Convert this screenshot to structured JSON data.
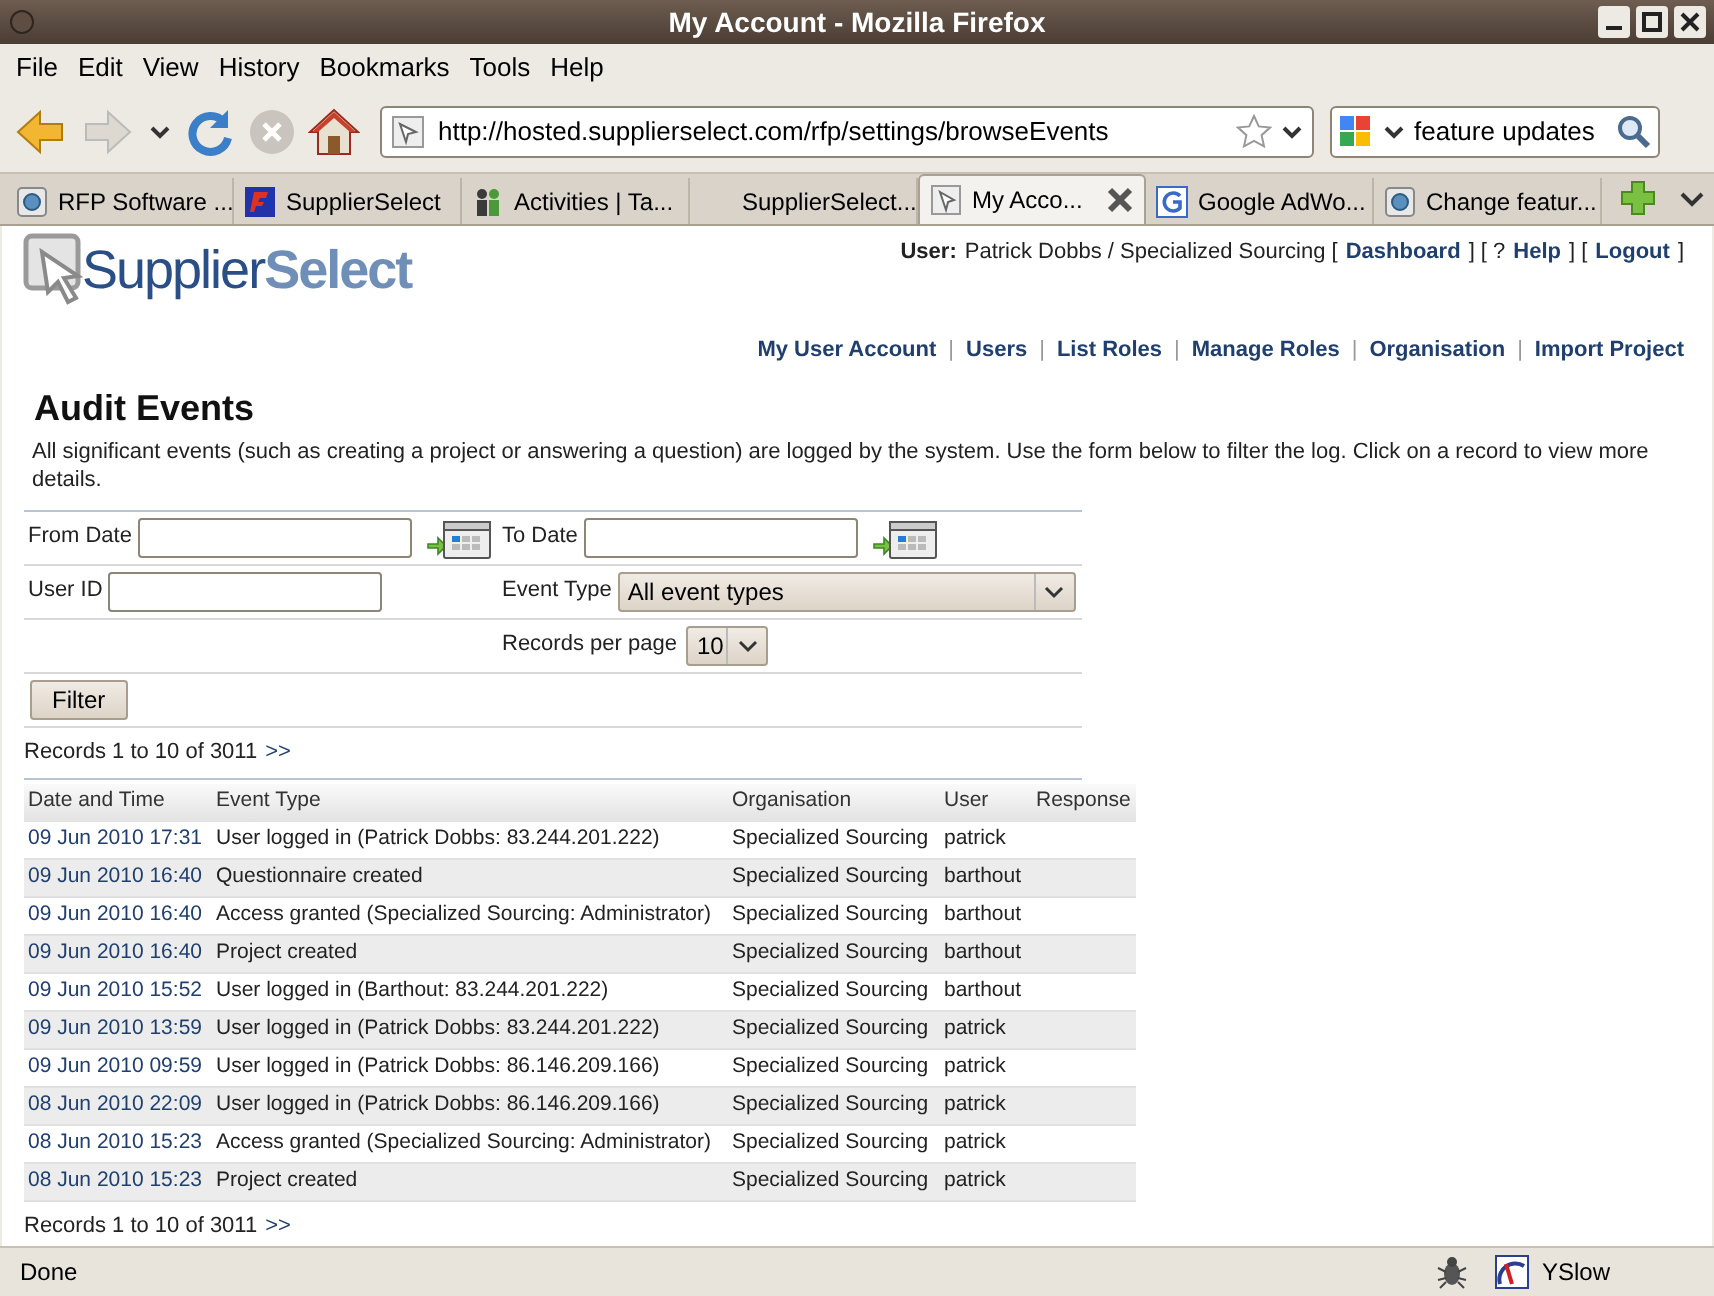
{
  "window": {
    "title": "My Account - Mozilla Firefox"
  },
  "menu": [
    "File",
    "Edit",
    "View",
    "History",
    "Bookmarks",
    "Tools",
    "Help"
  ],
  "nav_buttons": [
    {
      "kind": "back",
      "disabled": false
    },
    {
      "kind": "forward",
      "disabled": true
    },
    {
      "kind": "history",
      "disabled": false
    },
    {
      "kind": "reload",
      "disabled": false
    },
    {
      "kind": "stop",
      "disabled": true
    },
    {
      "kind": "home",
      "disabled": false
    }
  ],
  "address_bar": {
    "url": "http://hosted.supplierselect.com/rfp/settings/browseEvents"
  },
  "search_bar": {
    "value": "feature updates"
  },
  "tabs": [
    {
      "label": "RFP Software ...",
      "kind": "globe",
      "selected": false
    },
    {
      "label": "SupplierSelect",
      "kind": "logo",
      "selected": false
    },
    {
      "label": "Activities | Ta...",
      "kind": "people",
      "selected": false
    },
    {
      "label": "SupplierSelect...",
      "kind": "blank",
      "selected": false
    },
    {
      "label": "My Acco...",
      "kind": "page",
      "selected": true
    },
    {
      "label": "Google AdWo...",
      "kind": "google",
      "selected": false
    },
    {
      "label": "Change featur...",
      "kind": "globe",
      "selected": false
    }
  ],
  "page": {
    "logo": {
      "part_1": "Supplier",
      "part_2": "Select"
    },
    "user_bar": [
      {
        "kind": "label",
        "text": "User:"
      },
      {
        "kind": "text",
        "text": "Patrick Dobbs / Specialized Sourcing ["
      },
      {
        "kind": "link",
        "text": "Dashboard"
      },
      {
        "kind": "text",
        "text": "] [ ?"
      },
      {
        "kind": "link",
        "text": "Help"
      },
      {
        "kind": "text",
        "text": "] ["
      },
      {
        "kind": "link",
        "text": "Logout"
      },
      {
        "kind": "text",
        "text": "]"
      }
    ],
    "nav_links": [
      {
        "kind": "link",
        "text": "My User Account"
      },
      {
        "kind": "sep",
        "text": "|"
      },
      {
        "kind": "link",
        "text": "Users"
      },
      {
        "kind": "sep",
        "text": "|"
      },
      {
        "kind": "link",
        "text": "List Roles"
      },
      {
        "kind": "sep",
        "text": "|"
      },
      {
        "kind": "link",
        "text": "Manage Roles"
      },
      {
        "kind": "sep",
        "text": "|"
      },
      {
        "kind": "link",
        "text": "Organisation"
      },
      {
        "kind": "sep",
        "text": "|"
      },
      {
        "kind": "link",
        "text": "Import Project"
      }
    ],
    "heading": "Audit Events",
    "intro": "All significant events (such as creating a project or answering a question) are logged by the system. Use the form below to filter the log. Click on a record to view more details.",
    "filter_form": {
      "from_date": {
        "label": "From Date"
      },
      "to_date": {
        "label": "To Date"
      },
      "user_id": {
        "label": "User ID"
      },
      "event_type": {
        "label": "Event Type",
        "value": "All event types"
      },
      "records_per_page": {
        "label": "Records per page",
        "value": "10"
      },
      "button": "Filter"
    },
    "records_top": {
      "text": "Records 1 to 10 of 3011",
      "next": ">>"
    },
    "table": {
      "columns": [
        "Date and Time",
        "Event Type",
        "Organisation",
        "User",
        "Response"
      ],
      "rows": [
        [
          "09 Jun 2010 17:31",
          "User logged in (Patrick Dobbs: 83.244.201.222)",
          "Specialized Sourcing",
          "patrick"
        ],
        [
          "09 Jun 2010 16:40",
          "Questionnaire created",
          "Specialized Sourcing",
          "barthout"
        ],
        [
          "09 Jun 2010 16:40",
          "Access granted (Specialized Sourcing: Administrator)",
          "Specialized Sourcing",
          "barthout"
        ],
        [
          "09 Jun 2010 16:40",
          "Project created",
          "Specialized Sourcing",
          "barthout"
        ],
        [
          "09 Jun 2010 15:52",
          "User logged in (Barthout: 83.244.201.222)",
          "Specialized Sourcing",
          "barthout"
        ],
        [
          "09 Jun 2010 13:59",
          "User logged in (Patrick Dobbs: 83.244.201.222)",
          "Specialized Sourcing",
          "patrick"
        ],
        [
          "09 Jun 2010 09:59",
          "User logged in (Patrick Dobbs: 86.146.209.166)",
          "Specialized Sourcing",
          "patrick"
        ],
        [
          "08 Jun 2010 22:09",
          "User logged in (Patrick Dobbs: 86.146.209.166)",
          "Specialized Sourcing",
          "patrick"
        ],
        [
          "08 Jun 2010 15:23",
          "Access granted (Specialized Sourcing: Administrator)",
          "Specialized Sourcing",
          "patrick"
        ],
        [
          "08 Jun 2010 15:23",
          "Project created",
          "Specialized Sourcing",
          "patrick"
        ]
      ]
    },
    "records_bottom": {
      "text": "Records 1 to 10 of 3011",
      "next": ">>"
    }
  },
  "status_bar": {
    "text": "Done",
    "addon": "YSlow"
  }
}
